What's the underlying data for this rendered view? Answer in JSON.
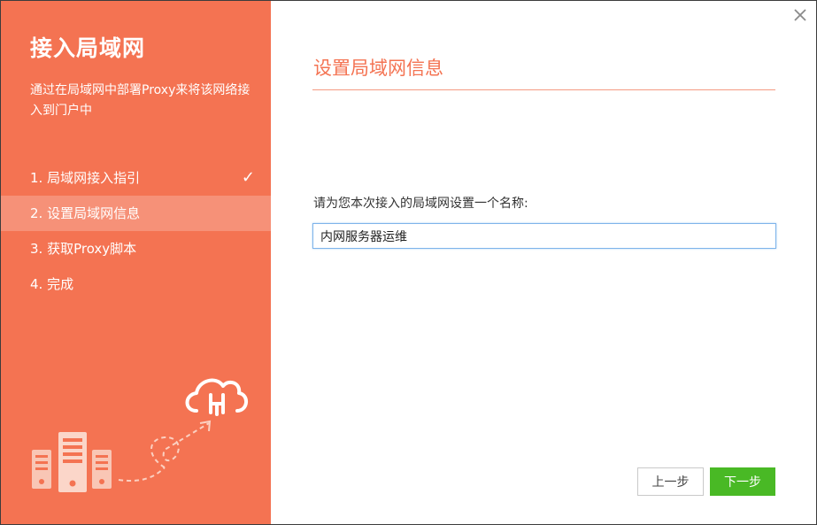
{
  "sidebar": {
    "title": "接入局域网",
    "description": "通过在局域网中部署Proxy来将该网络接入到门户中",
    "steps": [
      {
        "label": "1. 局域网接入指引",
        "completed": true
      },
      {
        "label": "2. 设置局域网信息",
        "active": true
      },
      {
        "label": "3. 获取Proxy脚本"
      },
      {
        "label": "4. 完成"
      }
    ],
    "illustration_icons": [
      "server-rack-icon",
      "cloud-upload-icon"
    ]
  },
  "main": {
    "title": "设置局域网信息",
    "field_label": "请为您本次接入的局域网设置一个名称:",
    "field_value": "内网服务器运维"
  },
  "buttons": {
    "prev": "上一步",
    "next": "下一步"
  },
  "icons": {
    "close": "close-icon",
    "check": "check-icon"
  },
  "colors": {
    "sidebar": "#f47352",
    "accent": "#f47352",
    "next_button": "#49b925",
    "input_border": "#7eb4ea"
  }
}
